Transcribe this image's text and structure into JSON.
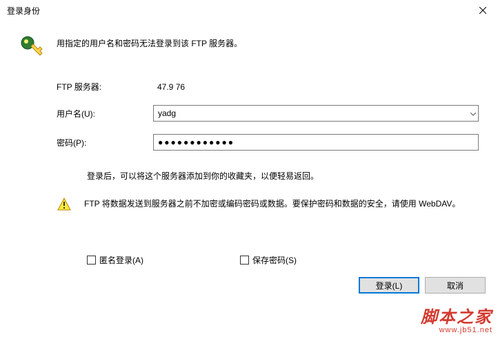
{
  "titlebar": {
    "title": "登录身份"
  },
  "header": {
    "message": "用指定的用户名和密码无法登录到该 FTP 服务器。"
  },
  "fields": {
    "server_label": "FTP 服务器:",
    "server_value": "47.9        76",
    "username_label": "用户名(U):",
    "username_value": "yadg",
    "password_label": "密码(P):",
    "password_value": "●●●●●●●●●●●●"
  },
  "info": {
    "after_login": "登录后，可以将这个服务器添加到你的收藏夹，以便轻易返回。"
  },
  "warning": {
    "text": "FTP 将数据发送到服务器之前不加密或编码密码或数据。要保护密码和数据的安全，请使用 WebDAV。"
  },
  "checkboxes": {
    "anonymous": "匿名登录(A)",
    "save_password": "保存密码(S)"
  },
  "buttons": {
    "login": "登录(L)",
    "cancel": "取消"
  },
  "watermark": {
    "big": "脚本之家",
    "small": "www.jb51.net"
  }
}
